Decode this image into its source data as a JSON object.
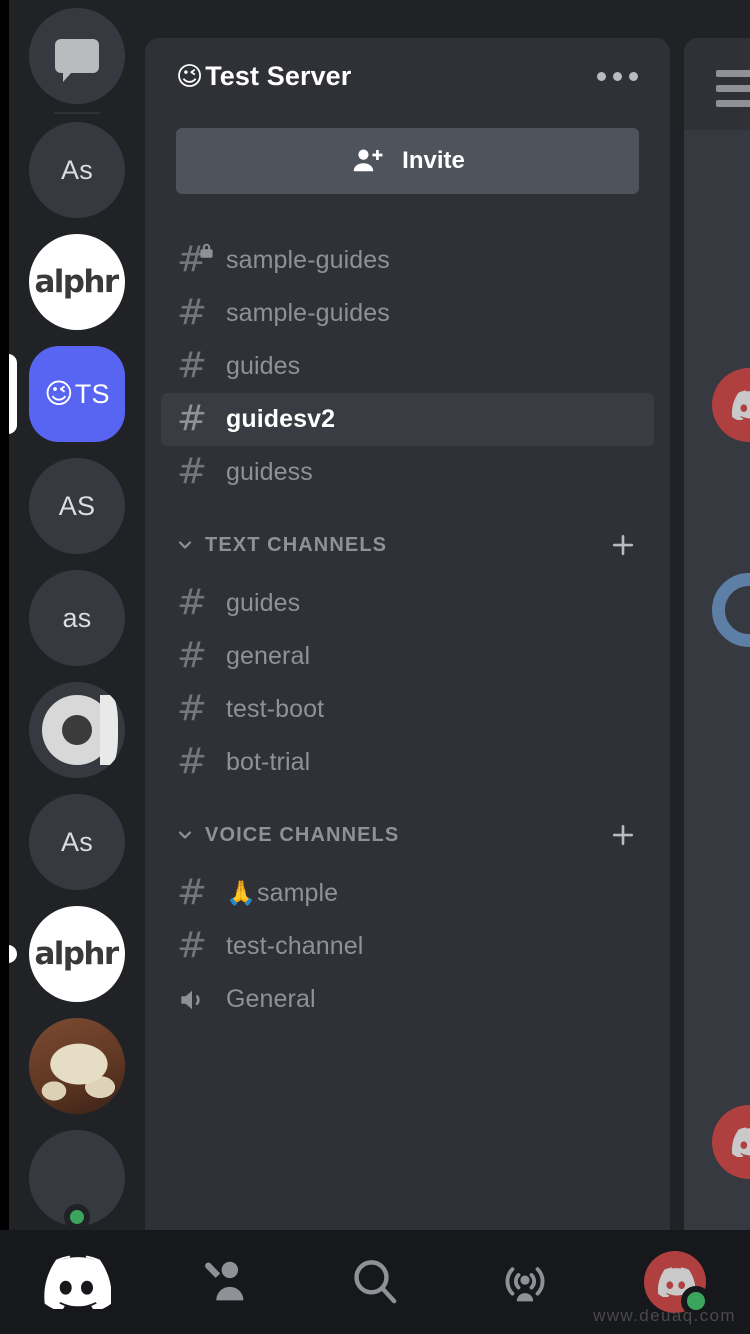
{
  "window": {
    "app": "Discord",
    "background_color": "#202225",
    "panel_color": "#2f3136",
    "accent_color": "#5865f2",
    "selected_row_color": "#393c43",
    "invite_button_color": "#4f535c",
    "muted_text_color": "#8e9297",
    "online_color": "#3ba55d"
  },
  "server_rail": {
    "items": [
      {
        "name": "direct-messages-home",
        "type": "home",
        "label": "",
        "selected": false
      },
      {
        "name": "server-as-1",
        "type": "initials",
        "label": "As",
        "selected": false
      },
      {
        "name": "server-alphr-1",
        "type": "wordmark",
        "label": "alphr",
        "selected": false
      },
      {
        "name": "server-test-server",
        "type": "active-server",
        "label": "TS",
        "emoji": "😉",
        "selected": true
      },
      {
        "name": "server-as-2",
        "type": "initials",
        "label": "AS",
        "selected": false
      },
      {
        "name": "server-as-3",
        "type": "initials",
        "label": "as",
        "selected": false
      },
      {
        "name": "server-logo-ring",
        "type": "logo",
        "label": "",
        "selected": false
      },
      {
        "name": "server-as-4",
        "type": "initials",
        "label": "As",
        "selected": false
      },
      {
        "name": "server-alphr-2",
        "type": "wordmark",
        "label": "alphr",
        "selected": false,
        "has_dot": true
      },
      {
        "name": "server-cat-photo",
        "type": "photo",
        "label": "",
        "selected": false
      },
      {
        "name": "server-partial",
        "type": "partial",
        "label": "",
        "selected": false,
        "online": true
      }
    ]
  },
  "header": {
    "server_emoji": "😉",
    "server_name": "Test Server",
    "more_label": "more-options"
  },
  "invite": {
    "label": "Invite",
    "icon": "person-add-icon"
  },
  "channels": {
    "ungrouped": [
      {
        "name": "sample-guides",
        "icon": "hash-locked-icon",
        "locked": true,
        "selected": false
      },
      {
        "name": "sample-guides",
        "icon": "hash-icon",
        "locked": false,
        "selected": false
      },
      {
        "name": "guides",
        "icon": "hash-icon",
        "locked": false,
        "selected": false
      },
      {
        "name": "guidesv2",
        "icon": "hash-icon",
        "locked": false,
        "selected": true
      },
      {
        "name": "guidess",
        "icon": "hash-icon",
        "locked": false,
        "selected": false
      }
    ],
    "categories": [
      {
        "label": "TEXT CHANNELS",
        "expanded": true,
        "add_label": "add-text-channel",
        "items": [
          {
            "name": "guides",
            "icon": "hash-icon",
            "emoji": "",
            "selected": false
          },
          {
            "name": "general",
            "icon": "hash-icon",
            "emoji": "",
            "selected": false
          },
          {
            "name": "test-boot",
            "icon": "hash-icon",
            "emoji": "",
            "selected": false
          },
          {
            "name": "bot-trial",
            "icon": "hash-icon",
            "emoji": "",
            "selected": false
          }
        ]
      },
      {
        "label": "VOICE CHANNELS",
        "expanded": true,
        "add_label": "add-voice-channel",
        "items": [
          {
            "name": "sample",
            "icon": "hash-icon",
            "emoji": "🙏",
            "selected": false
          },
          {
            "name": "test-channel",
            "icon": "hash-icon",
            "emoji": "",
            "selected": false
          },
          {
            "name": "General",
            "icon": "speaker-icon",
            "emoji": "",
            "selected": false
          }
        ]
      }
    ]
  },
  "peek_panel": {
    "menu_icon": "hamburger-menu-icon",
    "avatars": [
      "discord-avatar-red",
      "ring-avatar-blue",
      "discord-avatar-red"
    ]
  },
  "bottom_nav": {
    "items": [
      {
        "name": "nav-servers",
        "icon": "discord-logo-icon",
        "active": true
      },
      {
        "name": "nav-friends",
        "icon": "friends-icon",
        "active": false
      },
      {
        "name": "nav-search",
        "icon": "search-icon",
        "active": false
      },
      {
        "name": "nav-mentions",
        "icon": "broadcast-icon",
        "active": false
      },
      {
        "name": "nav-profile",
        "icon": "user-avatar-icon",
        "active": false
      }
    ]
  },
  "watermark": {
    "text": "www.deuaq.com"
  }
}
